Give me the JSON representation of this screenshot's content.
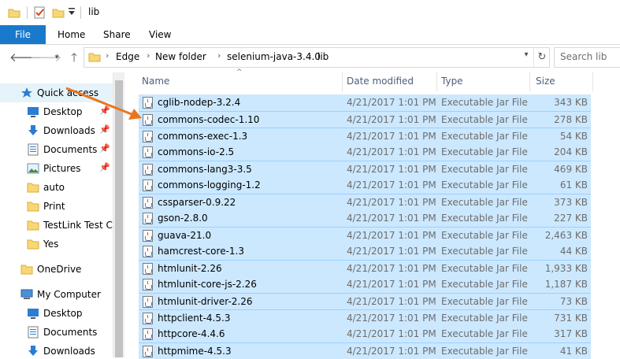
{
  "window": {
    "title": "lib"
  },
  "ribbon": {
    "file": "File",
    "home": "Home",
    "share": "Share",
    "view": "View"
  },
  "address": {
    "crumbs": [
      "Edge",
      "New folder",
      "selenium-java-3.4.0",
      "lib"
    ],
    "search_placeholder": "Search lib"
  },
  "nav": {
    "quick_access": "Quick access",
    "items": [
      {
        "label": "Desktop",
        "icon": "desktop-icon",
        "pinned": true
      },
      {
        "label": "Downloads",
        "icon": "downloads-icon",
        "pinned": true
      },
      {
        "label": "Documents",
        "icon": "documents-icon",
        "pinned": true
      },
      {
        "label": "Pictures",
        "icon": "pictures-icon",
        "pinned": true
      },
      {
        "label": "auto",
        "icon": "folder-icon",
        "pinned": false
      },
      {
        "label": "Print",
        "icon": "folder-icon",
        "pinned": false
      },
      {
        "label": "TestLink Test Cas",
        "icon": "folder-icon",
        "pinned": false
      },
      {
        "label": "Yes",
        "icon": "folder-icon",
        "pinned": false
      }
    ],
    "onedrive": "OneDrive",
    "computer": "My Computer",
    "computer_items": [
      {
        "label": "Desktop",
        "icon": "desktop-icon"
      },
      {
        "label": "Documents",
        "icon": "documents-icon"
      },
      {
        "label": "Downloads",
        "icon": "downloads-icon"
      }
    ]
  },
  "columns": {
    "name": "Name",
    "date": "Date modified",
    "type": "Type",
    "size": "Size"
  },
  "files": [
    {
      "name": "cglib-nodep-3.2.4",
      "date": "4/21/2017 1:01 PM",
      "type": "Executable Jar File",
      "size": "343 KB"
    },
    {
      "name": "commons-codec-1.10",
      "date": "4/21/2017 1:01 PM",
      "type": "Executable Jar File",
      "size": "278 KB"
    },
    {
      "name": "commons-exec-1.3",
      "date": "4/21/2017 1:01 PM",
      "type": "Executable Jar File",
      "size": "54 KB"
    },
    {
      "name": "commons-io-2.5",
      "date": "4/21/2017 1:01 PM",
      "type": "Executable Jar File",
      "size": "204 KB"
    },
    {
      "name": "commons-lang3-3.5",
      "date": "4/21/2017 1:01 PM",
      "type": "Executable Jar File",
      "size": "469 KB"
    },
    {
      "name": "commons-logging-1.2",
      "date": "4/21/2017 1:01 PM",
      "type": "Executable Jar File",
      "size": "61 KB"
    },
    {
      "name": "cssparser-0.9.22",
      "date": "4/21/2017 1:01 PM",
      "type": "Executable Jar File",
      "size": "373 KB"
    },
    {
      "name": "gson-2.8.0",
      "date": "4/21/2017 1:01 PM",
      "type": "Executable Jar File",
      "size": "227 KB"
    },
    {
      "name": "guava-21.0",
      "date": "4/21/2017 1:01 PM",
      "type": "Executable Jar File",
      "size": "2,463 KB"
    },
    {
      "name": "hamcrest-core-1.3",
      "date": "4/21/2017 1:01 PM",
      "type": "Executable Jar File",
      "size": "44 KB"
    },
    {
      "name": "htmlunit-2.26",
      "date": "4/21/2017 1:01 PM",
      "type": "Executable Jar File",
      "size": "1,933 KB"
    },
    {
      "name": "htmlunit-core-js-2.26",
      "date": "4/21/2017 1:01 PM",
      "type": "Executable Jar File",
      "size": "1,187 KB"
    },
    {
      "name": "htmlunit-driver-2.26",
      "date": "4/21/2017 1:01 PM",
      "type": "Executable Jar File",
      "size": "73 KB"
    },
    {
      "name": "httpclient-4.5.3",
      "date": "4/21/2017 1:01 PM",
      "type": "Executable Jar File",
      "size": "731 KB"
    },
    {
      "name": "httpcore-4.4.6",
      "date": "4/21/2017 1:01 PM",
      "type": "Executable Jar File",
      "size": "317 KB"
    },
    {
      "name": "httpmime-4.5.3",
      "date": "4/21/2017 1:01 PM",
      "type": "Executable Jar File",
      "size": "41 KB"
    }
  ],
  "colors": {
    "accent": "#1979ca",
    "selection": "#cce8ff",
    "annotation_arrow": "#e8761e"
  }
}
